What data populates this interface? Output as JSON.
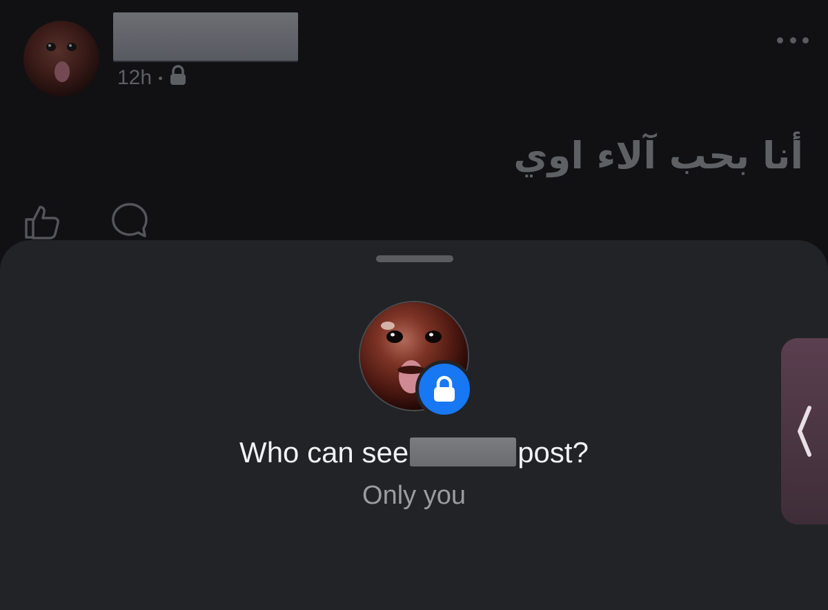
{
  "post": {
    "time": "12h",
    "privacy_icon": "lock-icon",
    "text": "أنا بحب آلاء اوي",
    "more_icon": "more-horizontal-icon",
    "actions": [
      "like-icon",
      "comment-icon"
    ]
  },
  "sheet": {
    "title_before": "Who can see",
    "title_after": "post?",
    "subtitle": "Only you",
    "badge_icon": "lock-icon"
  },
  "side_handle": {
    "icon": "chevron-left-icon"
  },
  "colors": {
    "accent_blue": "#1877f2",
    "sheet_background": "#222326",
    "page_background": "#111114",
    "side_handle": "#4f3846"
  }
}
